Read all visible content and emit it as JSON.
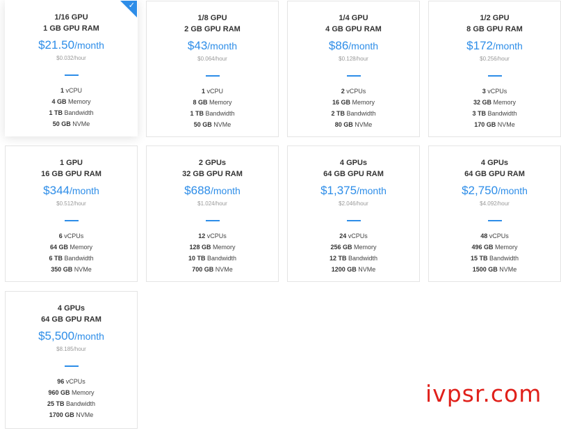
{
  "plans": [
    {
      "fraction": "1/16 GPU",
      "ram": "1 GB GPU RAM",
      "price": "$21.50",
      "per": "/month",
      "hourly": "$0.032/hour",
      "vcpu_num": "1",
      "vcpu_label": "vCPU",
      "mem_num": "4 GB",
      "mem_label": "Memory",
      "bw_num": "1 TB",
      "bw_label": "Bandwidth",
      "disk_num": "50 GB",
      "disk_label": "NVMe",
      "selected": true
    },
    {
      "fraction": "1/8 GPU",
      "ram": "2 GB GPU RAM",
      "price": "$43",
      "per": "/month",
      "hourly": "$0.064/hour",
      "vcpu_num": "1",
      "vcpu_label": "vCPU",
      "mem_num": "8 GB",
      "mem_label": "Memory",
      "bw_num": "1 TB",
      "bw_label": "Bandwidth",
      "disk_num": "50 GB",
      "disk_label": "NVMe",
      "selected": false
    },
    {
      "fraction": "1/4 GPU",
      "ram": "4 GB GPU RAM",
      "price": "$86",
      "per": "/month",
      "hourly": "$0.128/hour",
      "vcpu_num": "2",
      "vcpu_label": "vCPUs",
      "mem_num": "16 GB",
      "mem_label": "Memory",
      "bw_num": "2 TB",
      "bw_label": "Bandwidth",
      "disk_num": "80 GB",
      "disk_label": "NVMe",
      "selected": false
    },
    {
      "fraction": "1/2 GPU",
      "ram": "8 GB GPU RAM",
      "price": "$172",
      "per": "/month",
      "hourly": "$0.256/hour",
      "vcpu_num": "3",
      "vcpu_label": "vCPUs",
      "mem_num": "32 GB",
      "mem_label": "Memory",
      "bw_num": "3 TB",
      "bw_label": "Bandwidth",
      "disk_num": "170 GB",
      "disk_label": "NVMe",
      "selected": false
    },
    {
      "fraction": "1 GPU",
      "ram": "16 GB GPU RAM",
      "price": "$344",
      "per": "/month",
      "hourly": "$0.512/hour",
      "vcpu_num": "6",
      "vcpu_label": "vCPUs",
      "mem_num": "64 GB",
      "mem_label": "Memory",
      "bw_num": "6 TB",
      "bw_label": "Bandwidth",
      "disk_num": "350 GB",
      "disk_label": "NVMe",
      "selected": false
    },
    {
      "fraction": "2 GPUs",
      "ram": "32 GB GPU RAM",
      "price": "$688",
      "per": "/month",
      "hourly": "$1.024/hour",
      "vcpu_num": "12",
      "vcpu_label": "vCPUs",
      "mem_num": "128 GB",
      "mem_label": "Memory",
      "bw_num": "10 TB",
      "bw_label": "Bandwidth",
      "disk_num": "700 GB",
      "disk_label": "NVMe",
      "selected": false
    },
    {
      "fraction": "4 GPUs",
      "ram": "64 GB GPU RAM",
      "price": "$1,375",
      "per": "/month",
      "hourly": "$2.046/hour",
      "vcpu_num": "24",
      "vcpu_label": "vCPUs",
      "mem_num": "256 GB",
      "mem_label": "Memory",
      "bw_num": "12 TB",
      "bw_label": "Bandwidth",
      "disk_num": "1200 GB",
      "disk_label": "NVMe",
      "selected": false
    },
    {
      "fraction": "4 GPUs",
      "ram": "64 GB GPU RAM",
      "price": "$2,750",
      "per": "/month",
      "hourly": "$4.092/hour",
      "vcpu_num": "48",
      "vcpu_label": "vCPUs",
      "mem_num": "496 GB",
      "mem_label": "Memory",
      "bw_num": "15 TB",
      "bw_label": "Bandwidth",
      "disk_num": "1500 GB",
      "disk_label": "NVMe",
      "selected": false
    },
    {
      "fraction": "4 GPUs",
      "ram": "64 GB GPU RAM",
      "price": "$5,500",
      "per": "/month",
      "hourly": "$8.185/hour",
      "vcpu_num": "96",
      "vcpu_label": "vCPUs",
      "mem_num": "960 GB",
      "mem_label": "Memory",
      "bw_num": "25 TB",
      "bw_label": "Bandwidth",
      "disk_num": "1700 GB",
      "disk_label": "NVMe",
      "selected": false
    }
  ],
  "selected_check_icon": "checkmark-icon",
  "watermark": "ivpsr.com",
  "colors": {
    "accent": "#2d8de8",
    "watermark": "#e0201a",
    "text": "#333333",
    "muted": "#999999",
    "border": "#e4e4e4"
  }
}
